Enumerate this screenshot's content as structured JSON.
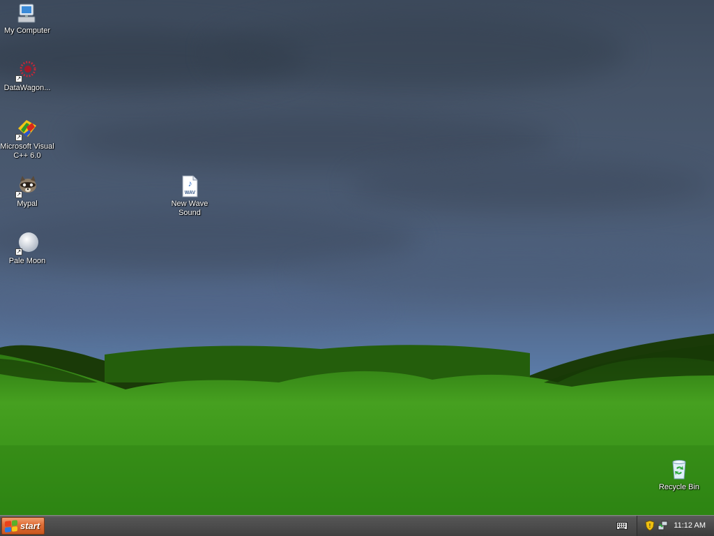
{
  "desktop": {
    "icons": [
      {
        "label": "My Computer",
        "icon": "my-computer-icon"
      },
      {
        "label": "DataWagon...",
        "icon": "datawagon-icon",
        "shortcut": true
      },
      {
        "label": "Microsoft Visual C++ 6.0",
        "icon": "visual-cpp-icon",
        "shortcut": true
      },
      {
        "label": "Mypal",
        "icon": "mypal-raccoon-icon",
        "shortcut": true
      },
      {
        "label": "Pale Moon",
        "icon": "pale-moon-icon",
        "shortcut": true
      },
      {
        "label": "New Wave Sound",
        "icon": "wav-file-icon",
        "badge": "WAV"
      },
      {
        "label": "Recycle Bin",
        "icon": "recycle-bin-icon"
      }
    ]
  },
  "taskbar": {
    "start_label": "start",
    "tray": {
      "keyboard_icon": "keyboard-icon",
      "security_icon": "security-shield-icon",
      "network_icon": "network-icon",
      "clock": "11:12 AM"
    }
  },
  "colors": {
    "start_button": "#e0703a",
    "taskbar": "#4a4a4a",
    "sky": "#4a5a72",
    "grass": "#3f9a1e"
  }
}
